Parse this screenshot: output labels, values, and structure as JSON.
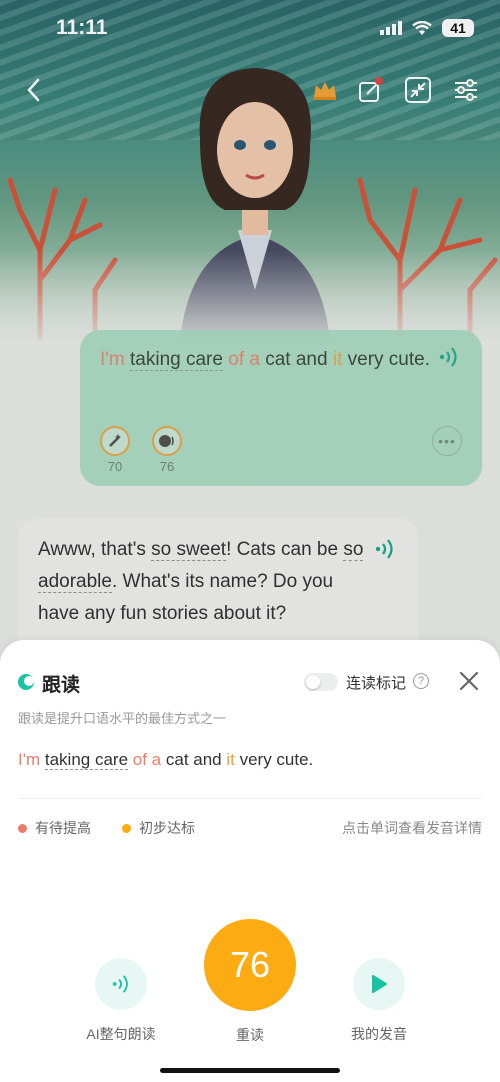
{
  "status_bar": {
    "time": "11:11",
    "battery": "41"
  },
  "chat": {
    "user_message": {
      "words": [
        {
          "text": "I'm",
          "style": "red"
        },
        {
          "text": " ",
          "style": ""
        },
        {
          "text": "taking care",
          "style": "dash"
        },
        {
          "text": " ",
          "style": ""
        },
        {
          "text": "of a",
          "style": "red"
        },
        {
          "text": " cat and ",
          "style": ""
        },
        {
          "text": "it",
          "style": "orange"
        },
        {
          "text": " very cute.",
          "style": ""
        }
      ],
      "scores": {
        "pronunciation": "70",
        "fluency": "76"
      }
    },
    "ai_message": {
      "text_1": "Awww, that's ",
      "highlight_1": "so sweet",
      "text_2": "! Cats can be ",
      "highlight_2": "so adorable",
      "text_3": ". What's its name? Do you have any fun stories about it?"
    }
  },
  "sheet": {
    "title": "跟读",
    "subtitle": "跟读是提升口语水平的最佳方式之一",
    "toggle_label": "连读标记",
    "help": "?",
    "sentence": {
      "w1": "I'm",
      "w2": "taking care",
      "w3": "of a",
      "w4": " cat and ",
      "w5": "it",
      "w6": " very cute."
    },
    "legend": {
      "needs_improvement": "有待提高",
      "basic": "初步达标",
      "hint": "点击单词查看发音详情"
    },
    "actions": {
      "ai_read_label": "AI整句朗读",
      "retry_label": "重读",
      "score": "76",
      "my_recording_label": "我的发音"
    }
  },
  "colors": {
    "needs_improvement": "#ec7d6a",
    "basic": "#fdab12",
    "accent": "#17c3a2"
  }
}
